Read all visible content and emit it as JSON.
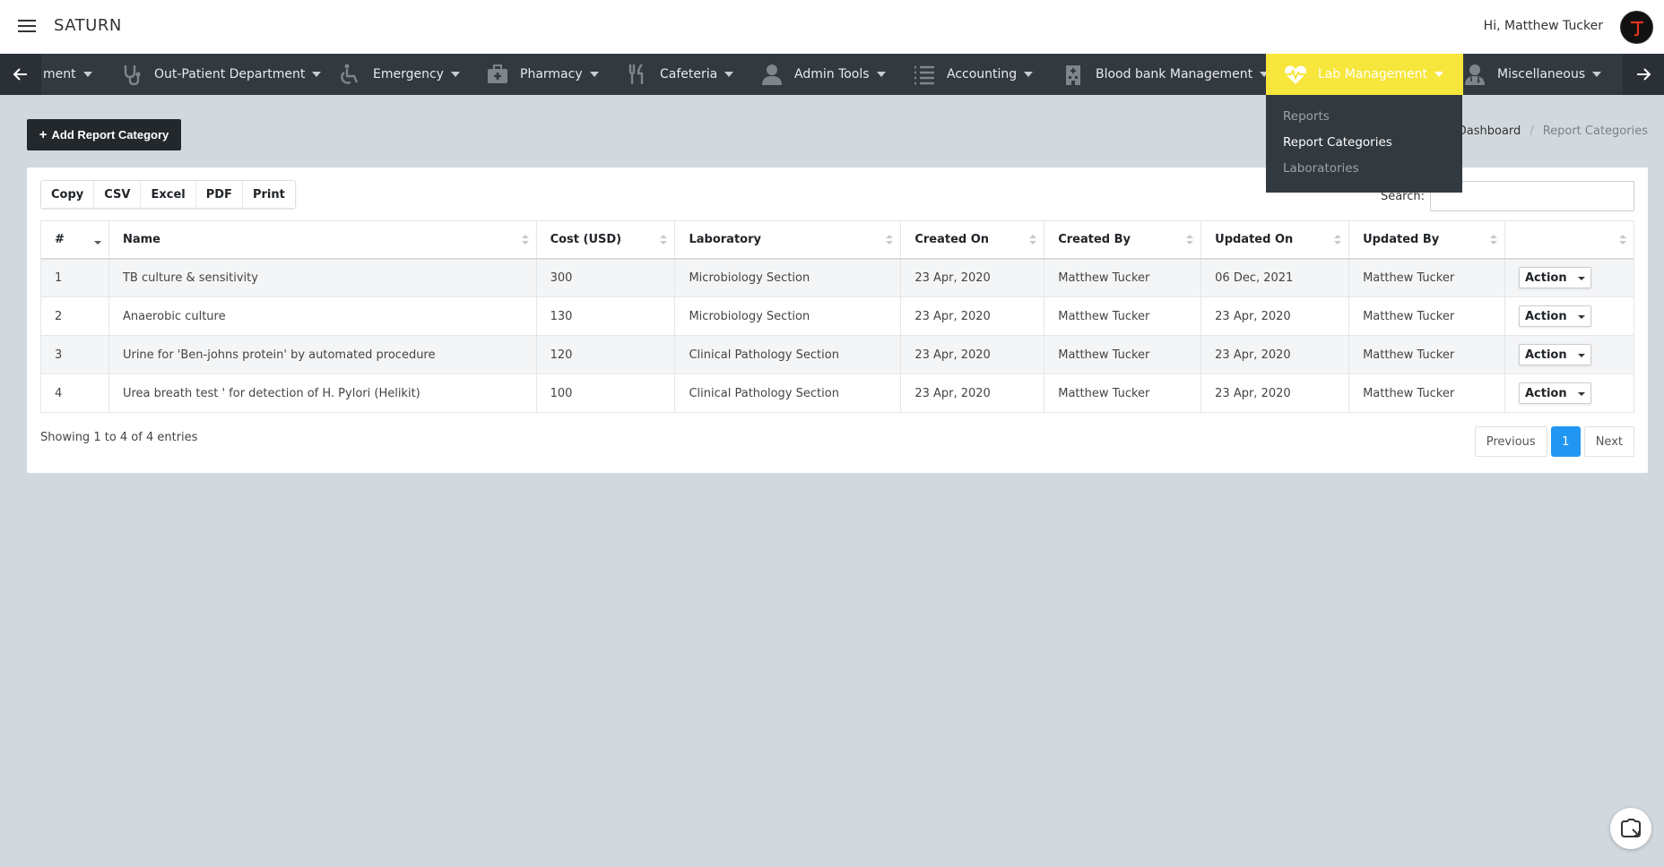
{
  "header": {
    "brand": "SATURN",
    "greeting": "Hi, Matthew Tucker"
  },
  "nav": {
    "items": [
      {
        "label": "ment",
        "icon": "clipped-icon"
      },
      {
        "label": "Out-Patient Department",
        "icon": "stethoscope-icon"
      },
      {
        "label": "Emergency",
        "icon": "wheelchair-icon"
      },
      {
        "label": "Pharmacy",
        "icon": "medkit-icon"
      },
      {
        "label": "Cafeteria",
        "icon": "utensils-icon"
      },
      {
        "label": "Admin Tools",
        "icon": "user-icon"
      },
      {
        "label": "Accounting",
        "icon": "list-icon"
      },
      {
        "label": "Blood bank Management",
        "icon": "hospital-building-icon"
      },
      {
        "label": "Lab Management",
        "icon": "heartbeat-icon",
        "active": true
      },
      {
        "label": "Miscellaneous",
        "icon": "user-doctor-icon"
      }
    ],
    "active_color": "#f7e63b",
    "bar_color": "#32393f"
  },
  "dropdown": {
    "items": [
      {
        "label": "Reports"
      },
      {
        "label": "Report Categories",
        "active": true
      },
      {
        "label": "Laboratories"
      }
    ]
  },
  "toolbar": {
    "add_label": "Add Report Category"
  },
  "breadcrumb": {
    "home": "Dashboard",
    "current": "Report Categories"
  },
  "exports": {
    "copy": "Copy",
    "csv": "CSV",
    "excel": "Excel",
    "pdf": "PDF",
    "print": "Print"
  },
  "search": {
    "label": "Search:",
    "value": ""
  },
  "table": {
    "columns": [
      "#",
      "Name",
      "Cost (USD)",
      "Laboratory",
      "Created On",
      "Created By",
      "Updated On",
      "Updated By",
      ""
    ],
    "rows": [
      [
        "1",
        "TB culture & sensitivity",
        "300",
        "Microbiology Section",
        "23 Apr, 2020",
        "Matthew Tucker",
        "06 Dec, 2021",
        "Matthew Tucker"
      ],
      [
        "2",
        "Anaerobic culture",
        "130",
        "Microbiology Section",
        "23 Apr, 2020",
        "Matthew Tucker",
        "23 Apr, 2020",
        "Matthew Tucker"
      ],
      [
        "3",
        "Urine for 'Ben-johns protein' by automated procedure",
        "120",
        "Clinical Pathology Section",
        "23 Apr, 2020",
        "Matthew Tucker",
        "23 Apr, 2020",
        "Matthew Tucker"
      ],
      [
        "4",
        "Urea breath test ' for detection of H. Pylori (Helikit)",
        "100",
        "Clinical Pathology Section",
        "23 Apr, 2020",
        "Matthew Tucker",
        "23 Apr, 2020",
        "Matthew Tucker"
      ]
    ],
    "action_label": "Action"
  },
  "footer": {
    "info": "Showing 1 to 4 of 4 entries",
    "prev": "Previous",
    "page": "1",
    "next": "Next"
  }
}
